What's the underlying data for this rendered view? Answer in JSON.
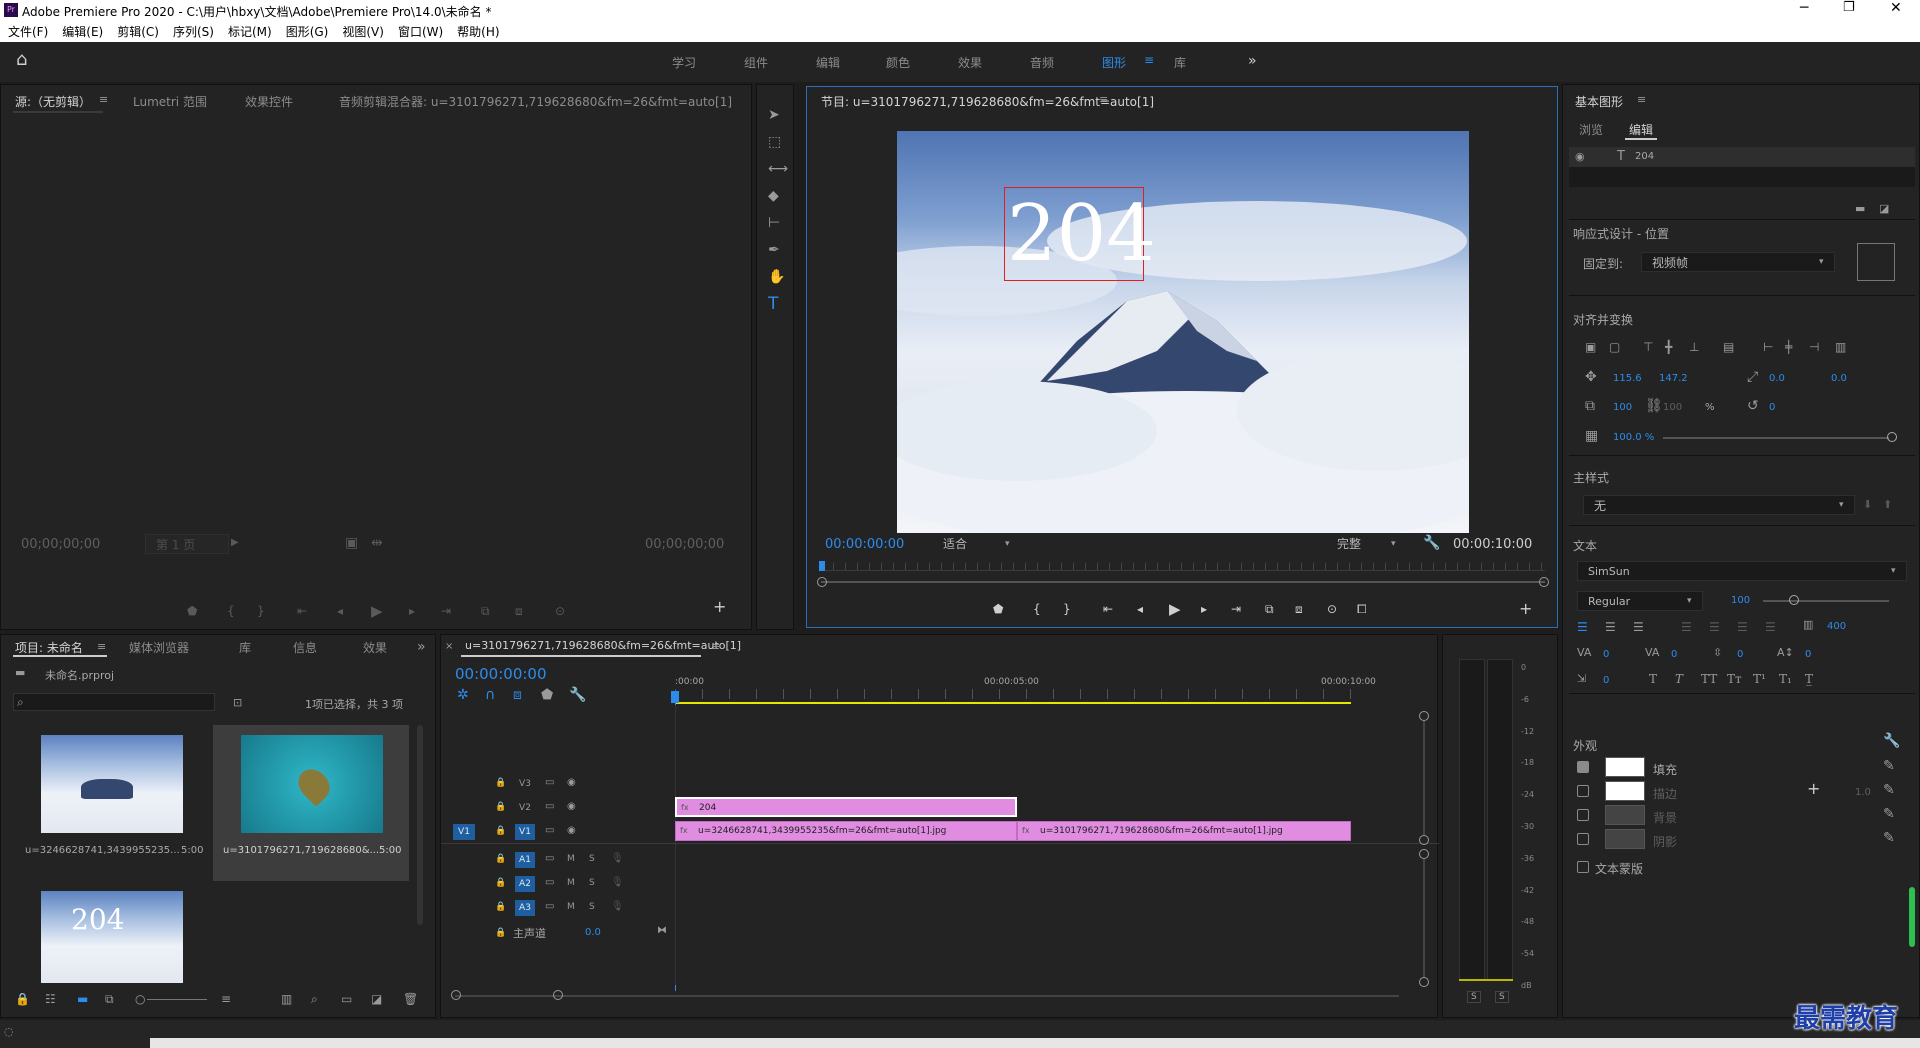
{
  "window": {
    "title": "Adobe Premiere Pro 2020 - C:\\用户\\hbxy\\文档\\Adobe\\Premiere Pro\\14.0\\未命名 *",
    "app_badge": "Pr"
  },
  "menu": [
    "文件(F)",
    "编辑(E)",
    "剪辑(C)",
    "序列(S)",
    "标记(M)",
    "图形(G)",
    "视图(V)",
    "窗口(W)",
    "帮助(H)"
  ],
  "workspaces": {
    "items": [
      "学习",
      "组件",
      "编辑",
      "颜色",
      "效果",
      "音频",
      "图形",
      "库"
    ],
    "active": "图形"
  },
  "source": {
    "tabs": [
      "源:（无剪辑）",
      "Lumetri 范围",
      "效果控件",
      "音频剪辑混合器: u=3101796271,719628680&fm=26&fmt=auto[1]"
    ],
    "timecode_left": "00;00;00;00",
    "timecode_right": "00;00;00;00",
    "page": "第 1 页"
  },
  "program": {
    "tab": "节目: u=3101796271,719628680&fm=26&fmt=auto[1]",
    "overlay_text": "204",
    "timecode": "00:00:00:00",
    "fit": "适合",
    "quality": "完整",
    "duration": "00:00:10:00"
  },
  "essential": {
    "title": "基本图形",
    "tabs": [
      "浏览",
      "编辑"
    ],
    "layer_name": "204",
    "responsive_label": "响应式设计 - 位置",
    "pin_label": "固定到:",
    "pin_value": "视频帧",
    "align_label": "对齐并变换",
    "pos_x": "115.6",
    "pos_y": "147.2",
    "anchor_x": "0.0",
    "anchor_y": "0.0",
    "scale": "100",
    "scale_h": "100",
    "percent": "%",
    "rotation": "0",
    "opacity": "100.0 %",
    "master_style_label": "主样式",
    "master_style_value": "无",
    "text_label": "文本",
    "font": "SimSun",
    "font_style": "Regular",
    "font_size": "100",
    "tracking": "400",
    "kerning": "0",
    "kerning2": "0",
    "leading": "0",
    "baseline": "0",
    "tsume": "0",
    "appearance_label": "外观",
    "fill": "填充",
    "stroke": "描边",
    "stroke_width": "1.0",
    "background": "背景",
    "shadow": "阴影",
    "mask": "文本蒙版"
  },
  "project": {
    "tabs": [
      "项目: 未命名",
      "媒体浏览器",
      "库",
      "信息",
      "效果"
    ],
    "file": "未命名.prproj",
    "selection": "1项已选择，共 3 项",
    "items": [
      {
        "name": "u=3246628741,3439955235...",
        "duration": "5:00"
      },
      {
        "name": "u=3101796271,719628680&...",
        "duration": "5:00"
      },
      {
        "name": "204",
        "duration": ""
      }
    ]
  },
  "timeline": {
    "tab": "u=3101796271,719628680&fm=26&fmt=auto[1]",
    "timecode": "00:00:00:00",
    "ruler": [
      ":00:00",
      "00:00:05:00",
      "00:00:10:00"
    ],
    "video_tracks": [
      "V3",
      "V2",
      "V1"
    ],
    "audio_tracks": [
      "A1",
      "A2",
      "A3"
    ],
    "master": "主声道",
    "master_value": "0.0",
    "source_patch": "V1",
    "clips": [
      {
        "label": "204"
      },
      {
        "label": "u=3246628741,3439955235&fm=26&fmt=auto[1].jpg"
      },
      {
        "label": "u=3101796271,719628680&fm=26&fmt=auto[1].jpg"
      }
    ]
  },
  "meter": {
    "scale": [
      "0",
      "-6",
      "-12",
      "-18",
      "-24",
      "-30",
      "-36",
      "-42",
      "-48",
      "-54",
      "dB"
    ],
    "solo": [
      "S",
      "S"
    ]
  },
  "watermark": "最需教育",
  "colors": {
    "accent": "#2d8ceb",
    "clip": "#e08ce0",
    "playhead": "#2d8ceb",
    "workarea": "#e6e600"
  }
}
